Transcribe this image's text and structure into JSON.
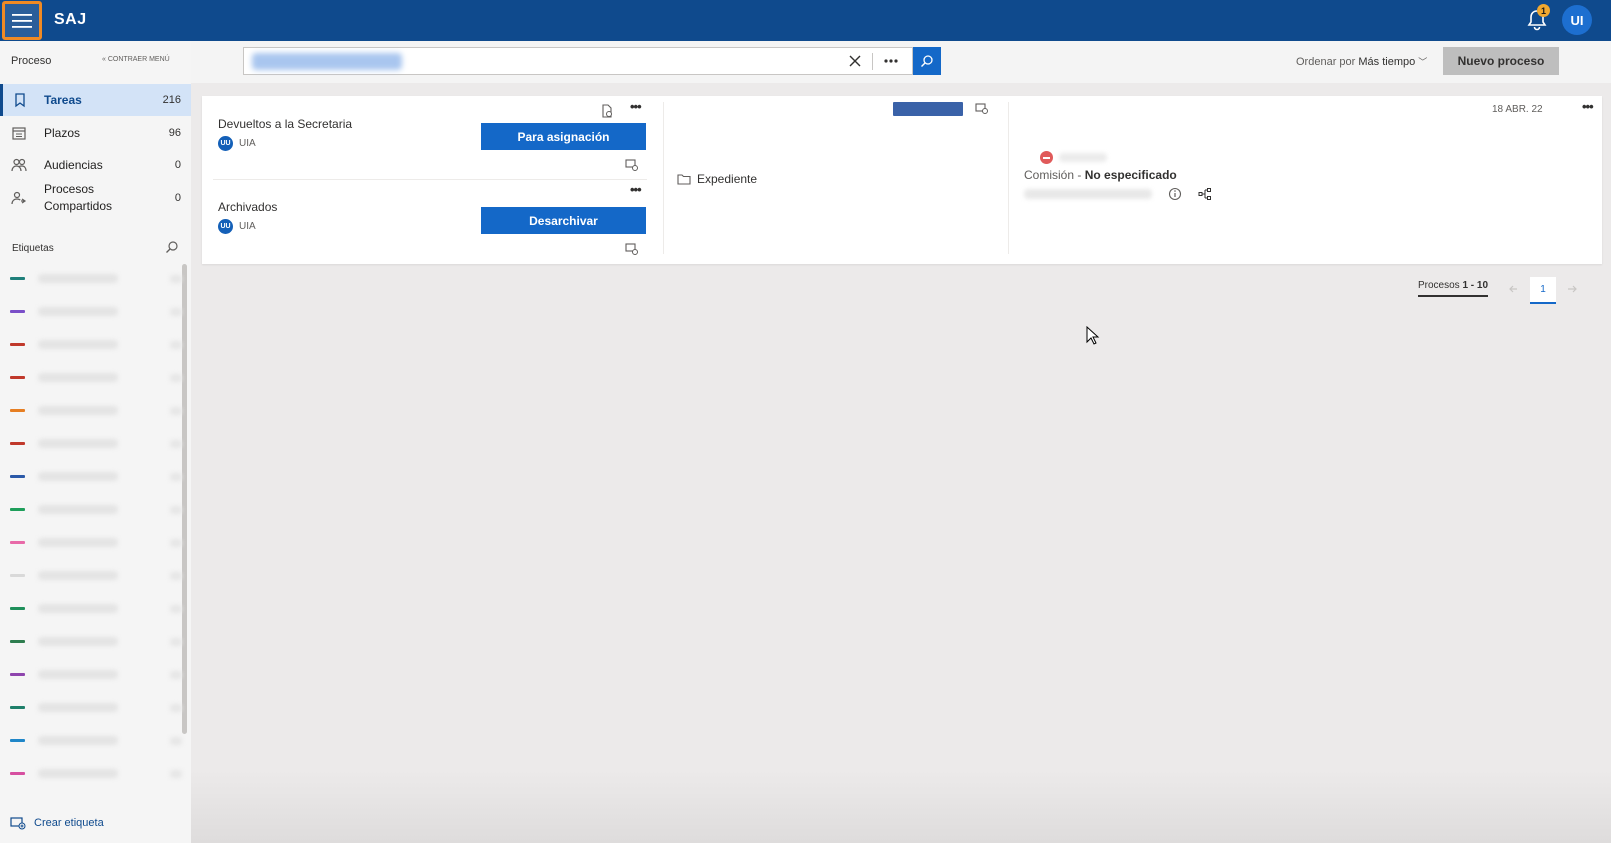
{
  "app": {
    "brand": "SAJ",
    "notification_count": "1",
    "user_initials": "UI"
  },
  "sidebar": {
    "section_title": "Proceso",
    "collapse_label": "CONTRAER MENÚ",
    "items": [
      {
        "label": "Tareas",
        "count": "216",
        "icon": "bookmark-icon"
      },
      {
        "label": "Plazos",
        "count": "96",
        "icon": "calendar-icon"
      },
      {
        "label": "Audiencias",
        "count": "0",
        "icon": "people-icon"
      },
      {
        "label": "Procesos Compartidos",
        "count": "0",
        "icon": "share-people-icon"
      }
    ],
    "tags_title": "Etiquetas",
    "tag_colors": [
      "#1e7f7a",
      "#7a4fc8",
      "#c0392b",
      "#c0392b",
      "#e67e22",
      "#c0392b",
      "#2b59a8",
      "#1e9e5a",
      "#e86aa8",
      "#d9d9d9",
      "#1e8f5a",
      "#2e7d4f",
      "#8e44ad",
      "#1e7f6a",
      "#1f86c8",
      "#d64fa0"
    ],
    "create_tag_label": "Crear etiqueta"
  },
  "toolbar": {
    "order_prefix": "Ordenar por",
    "order_value": "Más tiempo",
    "new_process_label": "Nuevo proceso"
  },
  "card": {
    "tasks": [
      {
        "title": "Devueltos a la Secretaria",
        "assignee_initials": "UU",
        "assignee": "UIA",
        "action": "Para asignación"
      },
      {
        "title": "Archivados",
        "assignee_initials": "UU",
        "assignee": "UIA",
        "action": "Desarchivar"
      }
    ],
    "expediente_label": "Expediente",
    "date": "18 ABR. 22",
    "comision_label": "Comisión -",
    "comision_value": "No especificado"
  },
  "pagination": {
    "label": "Procesos",
    "range": "1 - 10",
    "current_page": "1"
  },
  "colors": {
    "topbar": "#0f4a8d",
    "primary_button": "#1468c8",
    "highlight_border": "#f08a24"
  }
}
